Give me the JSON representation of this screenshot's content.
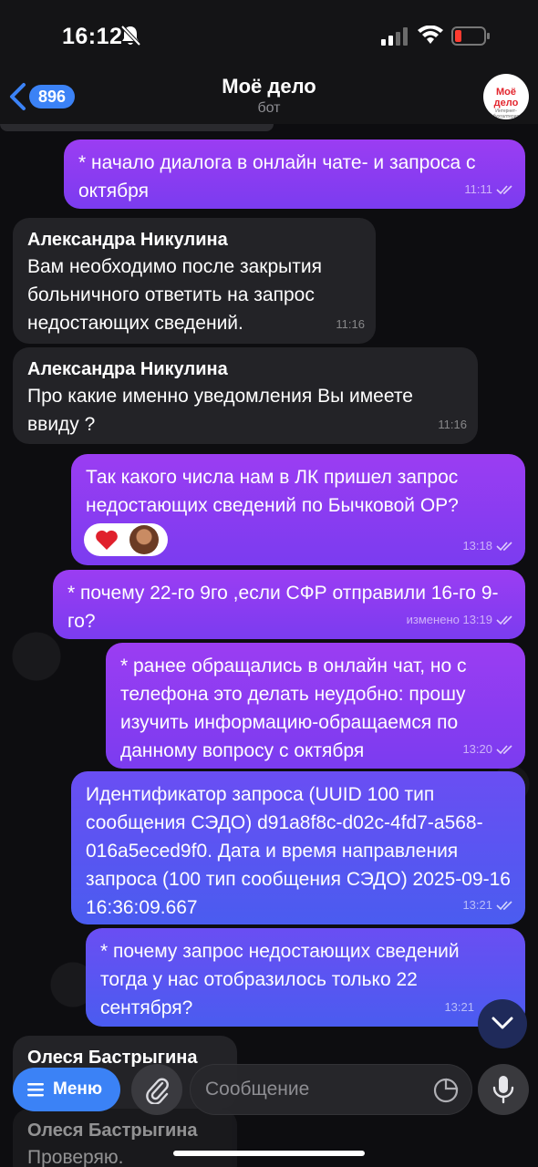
{
  "status_bar": {
    "time": "16:12"
  },
  "header": {
    "back_count": "896",
    "title": "Моё дело",
    "subtitle": "бот",
    "avatar_text": "Моё дело",
    "avatar_subtext": "Интернет-бухгалтерия"
  },
  "messages": [
    {
      "direction": "out",
      "text": "* начало диалога в онлайн чате- и запроса с октября",
      "time": "11:11"
    },
    {
      "direction": "in",
      "sender": "Александра Никулина",
      "text": "Вам необходимо после закрытия больничного ответить на запрос недостающих сведений.",
      "time": "11:16"
    },
    {
      "direction": "in",
      "sender": "Александра Никулина",
      "text": "Про какие именно уведомления Вы имеете ввиду ?",
      "time": "11:16"
    },
    {
      "direction": "out",
      "text": "Так какого числа нам в ЛК пришел запрос недостающих сведений по Бычковой ОР?",
      "time": "13:18",
      "reactions": [
        "heart"
      ]
    },
    {
      "direction": "out",
      "text": "* почему 22-го 9го ,если СФР отправили 16-го 9-го?",
      "time": "изменено 13:19"
    },
    {
      "direction": "out",
      "text": "* ранее обращались в онлайн чат, но с телефона это делать неудобно: прошу изучить информацию-обращаемся по данному вопросу с октября",
      "time": "13:20"
    },
    {
      "direction": "out",
      "text": "Идентификатор запроса (UUID 100 тип сообщения СЭДО) d91a8f8c-d02c-4fd7-a568-016a5eced9f0. Дата и время направления запроса (100 тип сообщения СЭДО) 2025-09-16 16:36:09.667",
      "time": "13:21"
    },
    {
      "direction": "out",
      "text": "* почему запрос недостающих сведений тогда у нас отобразилось только 22 сентября?",
      "time": "13:21"
    },
    {
      "direction": "in",
      "sender": "Олеся Бастрыгина",
      "text": "",
      "time": ""
    },
    {
      "direction": "in",
      "sender": "Олеся Бастрыгина",
      "text": "Проверяю.",
      "time": ""
    }
  ],
  "input_bar": {
    "menu_label": "Меню",
    "placeholder": "Сообщение"
  },
  "colors": {
    "accent": "#3b82f6",
    "outgoing_bubble": "#8b3cf1",
    "incoming_bubble": "#232327"
  }
}
